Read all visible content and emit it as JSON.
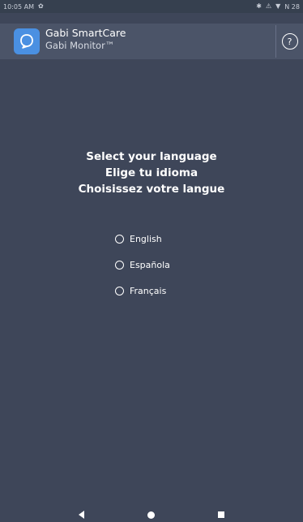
{
  "status_bar": {
    "time": "10:05 AM",
    "gear_glyph": "✿",
    "right_icons": [
      "✱",
      "⚠",
      "▼"
    ],
    "battery_text": "N 28"
  },
  "app_bar": {
    "title": "Gabi SmartCare",
    "subtitle": "Gabi Monitor™",
    "logo_icon": "Q",
    "help_symbol": "?"
  },
  "prompt": {
    "line_en": "Select your language",
    "line_es": "Elige tu idioma",
    "line_fr": "Choisissez votre langue"
  },
  "languages": [
    {
      "label": "English",
      "selected": false
    },
    {
      "label": "Española",
      "selected": false
    },
    {
      "label": "Français",
      "selected": false
    }
  ],
  "colors": {
    "background": "#3e4659",
    "app_bar": "#4b5468",
    "status_bar": "#36404f",
    "logo": "#4a90e2",
    "text": "#ffffff"
  }
}
